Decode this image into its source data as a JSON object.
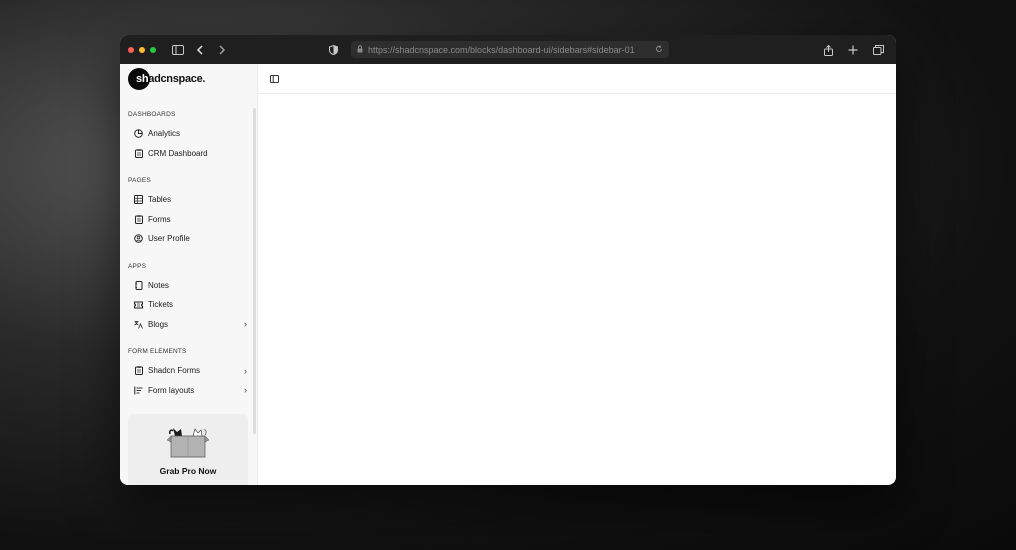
{
  "browser": {
    "url": "https://shadcnspace.com/blocks/dashboard-ui/sidebars#sidebar-01",
    "traffic_colors": [
      "#ff5f57",
      "#febc2e",
      "#28c840"
    ],
    "icons": [
      "sidebar-toggle-icon",
      "back-icon",
      "forward-icon",
      "shield-icon",
      "lock-icon",
      "reload-icon",
      "share-icon",
      "new-tab-icon",
      "tabs-icon"
    ]
  },
  "sidebar": {
    "logo_prefix": "sh",
    "logo_rest": "adcnspace.",
    "sections": [
      {
        "title": "DASHBOARDS",
        "items": [
          {
            "label": "Analytics",
            "icon": "pie-chart-icon"
          },
          {
            "label": "CRM Dashboard",
            "icon": "clipboard-icon"
          }
        ]
      },
      {
        "title": "PAGES",
        "items": [
          {
            "label": "Tables",
            "icon": "table-icon"
          },
          {
            "label": "Forms",
            "icon": "clipboard-icon"
          },
          {
            "label": "User Profile",
            "icon": "user-circle-icon"
          }
        ]
      },
      {
        "title": "APPS",
        "items": [
          {
            "label": "Notes",
            "icon": "notes-icon"
          },
          {
            "label": "Tickets",
            "icon": "ticket-icon"
          },
          {
            "label": "Blogs",
            "icon": "translate-icon",
            "chevron": true
          }
        ]
      },
      {
        "title": "FORM ELEMENTS",
        "items": [
          {
            "label": "Shadcn Forms",
            "icon": "clipboard-icon",
            "chevron": true
          },
          {
            "label": "Form layouts",
            "icon": "layout-icon",
            "chevron": true
          }
        ]
      }
    ],
    "promo": {
      "title": "Grab Pro Now"
    }
  },
  "main": {
    "toggle_icon": "panel-toggle-icon"
  }
}
